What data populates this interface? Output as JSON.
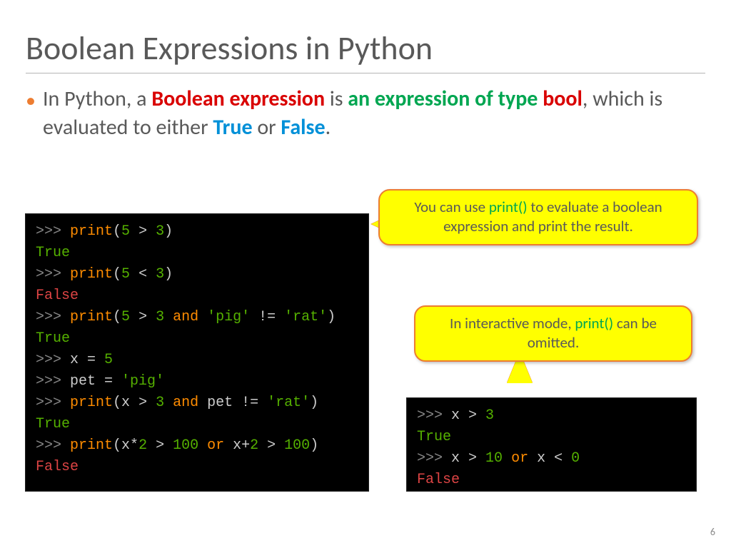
{
  "title": "Boolean Expressions in Python",
  "bullet": {
    "pre1": "In Python, a ",
    "boolean_expression": "Boolean expression",
    "mid1": " is ",
    "an_expression_of_type": "an expression of type ",
    "bool": "bool",
    "mid2": ", which is evaluated to either ",
    "true": "True",
    "mid3": " or ",
    "false": "False",
    "end": "."
  },
  "callout1": {
    "pre": "You can use ",
    "fn": "print()",
    "post": " to evaluate a boolean expression and print the result."
  },
  "callout2": {
    "pre": "In interactive mode, ",
    "fn": "print()",
    "post": " can be omitted."
  },
  "code_main": {
    "l1_prompt": ">>> ",
    "l1_print": "print",
    "l1_paren_o": "(",
    "l1_a": "5",
    "l1_op": " > ",
    "l1_b": "3",
    "l1_paren_c": ")",
    "l2": "True",
    "l3_prompt": ">>> ",
    "l3_print": "print",
    "l3_paren_o": "(",
    "l3_a": "5",
    "l3_op": " < ",
    "l3_b": "3",
    "l3_paren_c": ")",
    "l4": "False",
    "l5_prompt": ">>> ",
    "l5_print": "print",
    "l5_paren_o": "(",
    "l5_a": "5",
    "l5_op": " > ",
    "l5_b": "3",
    "l5_and": " and ",
    "l5_s1": "'pig'",
    "l5_ne": " != ",
    "l5_s2": "'rat'",
    "l5_paren_c": ")",
    "l6": "True",
    "l7_prompt": ">>> ",
    "l7_body": "x = ",
    "l7_val": "5",
    "l8_prompt": ">>> ",
    "l8_body": "pet = ",
    "l8_val": "'pig'",
    "l9_prompt": ">>> ",
    "l9_print": "print",
    "l9_paren_o": "(",
    "l9_x": "x ",
    "l9_op": "> ",
    "l9_b": "3",
    "l9_and": " and ",
    "l9_pet": "pet ",
    "l9_ne": "!= ",
    "l9_s2": "'rat'",
    "l9_paren_c": ")",
    "l10": "True",
    "l11_prompt": ">>> ",
    "l11_print": "print",
    "l11_paren_o": "(",
    "l11_e1a": "x*",
    "l11_e1n": "2",
    "l11_e1o": " > ",
    "l11_e1b": "100",
    "l11_or": " or ",
    "l11_e2a": "x+",
    "l11_e2n": "2",
    "l11_e2o": " > ",
    "l11_e2b": "100",
    "l11_paren_c": ")",
    "l12": "False"
  },
  "code_small": {
    "l1_prompt": ">>> ",
    "l1_x": "x ",
    "l1_op": "> ",
    "l1_b": "3",
    "l2": "True",
    "l3_prompt": ">>> ",
    "l3_x1": "x ",
    "l3_op1": "> ",
    "l3_b1": "10",
    "l3_or": " or ",
    "l3_x2": "x ",
    "l3_op2": "< ",
    "l3_b2": "0",
    "l4": "False"
  },
  "page_number": "6"
}
